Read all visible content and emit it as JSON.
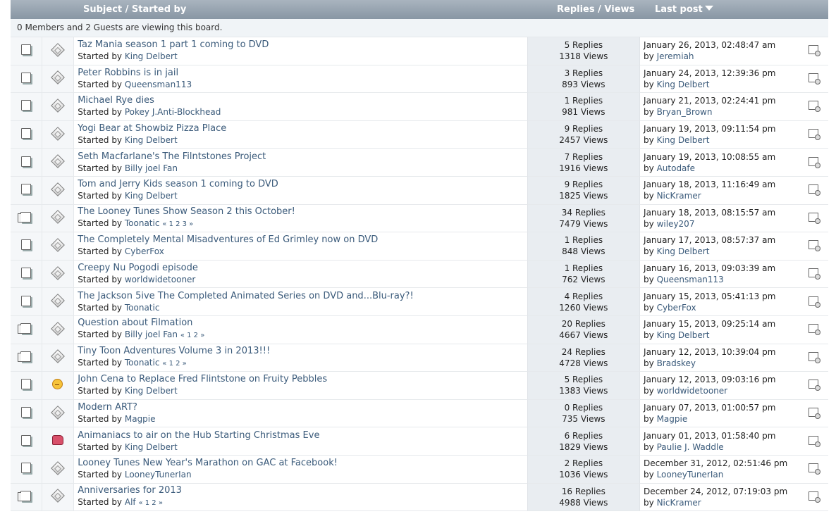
{
  "header": {
    "subject_label": "Subject / Started by",
    "stats_label": "Replies / Views",
    "last_post_label": "Last post"
  },
  "viewers_text": "0 Members and 2 Guests are viewing this board.",
  "icon_names": {
    "topic_icon_single": "single-page-topic-icon",
    "topic_icon_multi": "multi-page-topic-icon",
    "message_icon_default": "diamond-message-icon",
    "message_icon_angry": "angry-smiley-icon",
    "message_icon_thumbup": "thumbs-up-icon",
    "goto_last": "go-to-last-post-icon"
  },
  "topics": [
    {
      "subject": "Taz Mania season 1 part 1 coming to DVD",
      "started_prefix": "Started by ",
      "starter": "King Delbert",
      "pages": "",
      "replies": "5 Replies",
      "views": "1318 Views",
      "last_date": "January 26, 2013, 02:48:47 am",
      "by_prefix": "by ",
      "last_by": "Jeremiah",
      "topic_icon": "single",
      "msg_icon": "diamond"
    },
    {
      "subject": "Peter Robbins is in jail",
      "started_prefix": "Started by ",
      "starter": "Queensman113",
      "pages": "",
      "replies": "3 Replies",
      "views": "893 Views",
      "last_date": "January 24, 2013, 12:39:36 pm",
      "by_prefix": "by ",
      "last_by": "King Delbert",
      "topic_icon": "single",
      "msg_icon": "diamond"
    },
    {
      "subject": "Michael Rye dies",
      "started_prefix": "Started by ",
      "starter": "Pokey J.Anti-Blockhead",
      "pages": "",
      "replies": "1 Replies",
      "views": "981 Views",
      "last_date": "January 21, 2013, 02:24:41 pm",
      "by_prefix": "by ",
      "last_by": "Bryan_Brown",
      "topic_icon": "single",
      "msg_icon": "diamond"
    },
    {
      "subject": "Yogi Bear at Showbiz Pizza Place",
      "started_prefix": "Started by ",
      "starter": "King Delbert",
      "pages": "",
      "replies": "9 Replies",
      "views": "2457 Views",
      "last_date": "January 19, 2013, 09:11:54 pm",
      "by_prefix": "by ",
      "last_by": "King Delbert",
      "topic_icon": "single",
      "msg_icon": "diamond"
    },
    {
      "subject": "Seth Macfarlane's The Filntstones Project",
      "started_prefix": "Started by ",
      "starter": "Billy joel Fan",
      "pages": "",
      "replies": "7 Replies",
      "views": "1916 Views",
      "last_date": "January 19, 2013, 10:08:55 am",
      "by_prefix": "by ",
      "last_by": "Autodafe",
      "topic_icon": "single",
      "msg_icon": "diamond"
    },
    {
      "subject": "Tom and Jerry Kids season 1 coming to DVD",
      "started_prefix": "Started by ",
      "starter": "King Delbert",
      "pages": "",
      "replies": "9 Replies",
      "views": "1825 Views",
      "last_date": "January 18, 2013, 11:16:49 am",
      "by_prefix": "by ",
      "last_by": "NicKramer",
      "topic_icon": "single",
      "msg_icon": "diamond"
    },
    {
      "subject": "The Looney Tunes Show Season 2 this October!",
      "started_prefix": "Started by ",
      "starter": "Toonatic",
      "pages": "« 1 2 3 »",
      "replies": "34 Replies",
      "views": "7479 Views",
      "last_date": "January 18, 2013, 08:15:57 am",
      "by_prefix": "by ",
      "last_by": "wiley207",
      "topic_icon": "multi",
      "msg_icon": "diamond"
    },
    {
      "subject": "The Completely Mental Misadventures of Ed Grimley now on DVD",
      "started_prefix": "Started by ",
      "starter": "CyberFox",
      "pages": "",
      "replies": "1 Replies",
      "views": "848 Views",
      "last_date": "January 17, 2013, 08:57:37 am",
      "by_prefix": "by ",
      "last_by": "King Delbert",
      "topic_icon": "single",
      "msg_icon": "diamond"
    },
    {
      "subject": "Creepy Nu Pogodi episode",
      "started_prefix": "Started by ",
      "starter": "worldwidetooner",
      "pages": "",
      "replies": "1 Replies",
      "views": "762 Views",
      "last_date": "January 16, 2013, 09:03:39 am",
      "by_prefix": "by ",
      "last_by": "Queensman113",
      "topic_icon": "single",
      "msg_icon": "diamond"
    },
    {
      "subject": "The Jackson 5ive The Completed Animated Series on DVD and...Blu-ray?!",
      "started_prefix": "Started by ",
      "starter": "Toonatic",
      "pages": "",
      "replies": "4 Replies",
      "views": "1260 Views",
      "last_date": "January 15, 2013, 05:41:13 pm",
      "by_prefix": "by ",
      "last_by": "CyberFox",
      "topic_icon": "single",
      "msg_icon": "diamond"
    },
    {
      "subject": "Question about Filmation",
      "started_prefix": "Started by ",
      "starter": "Billy joel Fan",
      "pages": "« 1 2 »",
      "replies": "20 Replies",
      "views": "4667 Views",
      "last_date": "January 15, 2013, 09:25:14 am",
      "by_prefix": "by ",
      "last_by": "King Delbert",
      "topic_icon": "multi",
      "msg_icon": "diamond"
    },
    {
      "subject": "Tiny Toon Adventures Volume 3 in 2013!!!",
      "started_prefix": "Started by ",
      "starter": "Toonatic",
      "pages": "« 1 2 »",
      "replies": "24 Replies",
      "views": "4728 Views",
      "last_date": "January 12, 2013, 10:39:04 pm",
      "by_prefix": "by ",
      "last_by": "Bradskey",
      "topic_icon": "multi",
      "msg_icon": "diamond"
    },
    {
      "subject": "John Cena to Replace Fred Flintstone on Fruity Pebbles",
      "started_prefix": "Started by ",
      "starter": "King Delbert",
      "pages": "",
      "replies": "5 Replies",
      "views": "1383 Views",
      "last_date": "January 12, 2013, 09:03:16 pm",
      "by_prefix": "by ",
      "last_by": "worldwidetooner",
      "topic_icon": "single",
      "msg_icon": "angry"
    },
    {
      "subject": "Modern ART?",
      "started_prefix": "Started by ",
      "starter": "Magpie",
      "pages": "",
      "replies": "0 Replies",
      "views": "735 Views",
      "last_date": "January 07, 2013, 01:00:57 pm",
      "by_prefix": "by ",
      "last_by": "Magpie",
      "topic_icon": "single",
      "msg_icon": "diamond"
    },
    {
      "subject": "Animaniacs to air on the Hub Starting Christmas Eve",
      "started_prefix": "Started by ",
      "starter": "King Delbert",
      "pages": "",
      "replies": "6 Replies",
      "views": "1829 Views",
      "last_date": "January 01, 2013, 01:58:40 pm",
      "by_prefix": "by ",
      "last_by": "Paulie J. Waddle",
      "topic_icon": "single",
      "msg_icon": "thumbup"
    },
    {
      "subject": "Looney Tunes New Year's Marathon on GAC at Facebook!",
      "started_prefix": "Started by ",
      "starter": "LooneyTunerIan",
      "pages": "",
      "replies": "2 Replies",
      "views": "1036 Views",
      "last_date": "December 31, 2012, 02:51:46 pm",
      "by_prefix": "by ",
      "last_by": "LooneyTunerIan",
      "topic_icon": "single",
      "msg_icon": "diamond"
    },
    {
      "subject": "Anniversaries for 2013",
      "started_prefix": "Started by ",
      "starter": "Alf",
      "pages": "« 1 2 »",
      "replies": "16 Replies",
      "views": "4988 Views",
      "last_date": "December 24, 2012, 07:19:03 pm",
      "by_prefix": "by ",
      "last_by": "NicKramer",
      "topic_icon": "multi",
      "msg_icon": "diamond"
    }
  ]
}
